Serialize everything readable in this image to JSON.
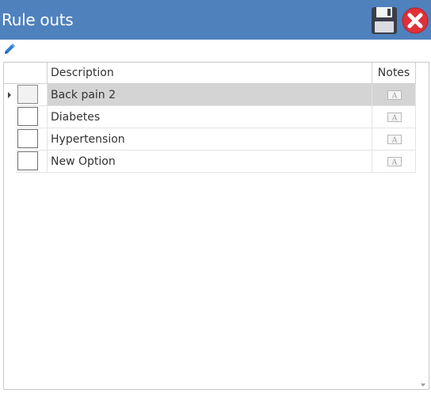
{
  "window": {
    "title": "Rule outs"
  },
  "toolbar": {
    "save_icon": "save-icon",
    "close_icon": "close-icon",
    "edit_icon": "pencil-icon"
  },
  "grid": {
    "columns": {
      "description": "Description",
      "notes": "Notes"
    },
    "rows": [
      {
        "description": "Back pain 2",
        "checked": false,
        "selected": true,
        "notes_icon": "text-note-icon"
      },
      {
        "description": "Diabetes",
        "checked": false,
        "selected": false,
        "notes_icon": "text-note-icon"
      },
      {
        "description": "Hypertension",
        "checked": false,
        "selected": false,
        "notes_icon": "text-note-icon"
      },
      {
        "description": "New Option",
        "checked": false,
        "selected": false,
        "notes_icon": "text-note-icon"
      }
    ]
  },
  "colors": {
    "titlebar": "#4f81bd",
    "selected_row": "#d4d4d4",
    "close_red": "#e0303a"
  }
}
